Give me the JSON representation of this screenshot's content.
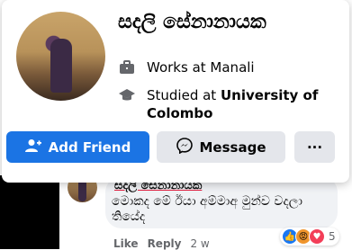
{
  "profile_card": {
    "name": "සදලි සේනානායක",
    "work": {
      "prefix": "Works at ",
      "place": "Manali"
    },
    "study": {
      "prefix": "Studied at ",
      "place_line1": "University of",
      "place_line2": "Colombo"
    },
    "buttons": {
      "add_friend": "Add Friend",
      "message": "Message",
      "more": "···"
    }
  },
  "comment": {
    "author": "සදලි සේනානායක",
    "text": "මොකද මේ ඊයා අම්මාඅ මුන්ව වදලා තියේද",
    "reaction_count": "5",
    "actions": {
      "like": "Like",
      "reply": "Reply",
      "time": "2 w"
    }
  },
  "colors": {
    "accent": "#1b74e4",
    "button_gray": "#e4e6eb",
    "bubble": "#f0f2f5",
    "underline": "#e41e3f"
  }
}
